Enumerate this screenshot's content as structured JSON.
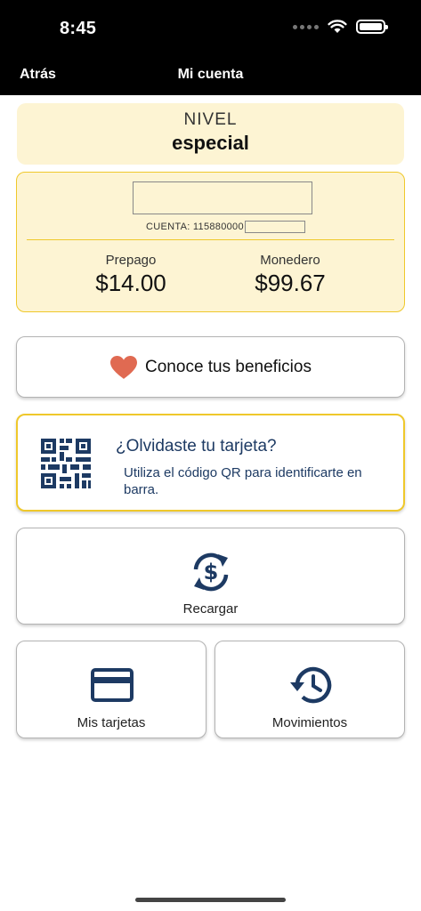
{
  "status_bar": {
    "time": "8:45"
  },
  "nav": {
    "back_label": "Atrás",
    "title": "Mi cuenta"
  },
  "level": {
    "label": "NIVEL",
    "value": "especial"
  },
  "account": {
    "account_prefix": "CUENTA: 115880000",
    "prepago_label": "Prepago",
    "prepago_value": "$14.00",
    "monedero_label": "Monedero",
    "monedero_value": "$99.67"
  },
  "benefits": {
    "label": "Conoce tus beneficios",
    "icon": "heart-icon"
  },
  "qr_card": {
    "title": "¿Olvidaste tu tarjeta?",
    "description": "Utiliza el código QR para identificarte en barra.",
    "icon": "qr-code-icon"
  },
  "actions": {
    "recargar_label": "Recargar",
    "mis_tarjetas_label": "Mis tarjetas",
    "movimientos_label": "Movimientos"
  },
  "colors": {
    "topbar": "#000000",
    "card_bg": "#fdf4d3",
    "accent_yellow": "#efc82b",
    "navy": "#1d3a63",
    "heart": "#e06a52"
  }
}
